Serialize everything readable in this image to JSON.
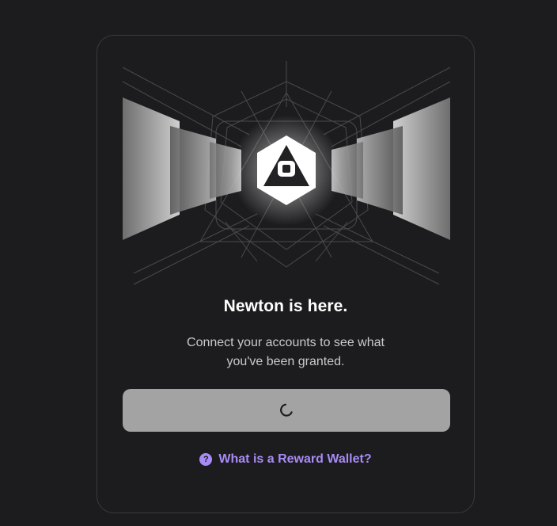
{
  "app": {
    "brand_name": "Newton",
    "logo_icon": "newton-triangle-logo-icon"
  },
  "card": {
    "title": "Newton is here.",
    "subtitle": "Connect your accounts to see what you've been granted."
  },
  "connect_button": {
    "state": "loading",
    "icon": "spinner-icon"
  },
  "help": {
    "icon": "question-circle-icon",
    "link_text": "What is a Reward Wallet?"
  },
  "colors": {
    "background": "#1c1c1e",
    "card_border": "#3a3a3d",
    "button_bg": "#a3a3a3",
    "accent": "#a98bf5",
    "title_text": "#ffffff",
    "subtitle_text": "#c9c9cc"
  }
}
